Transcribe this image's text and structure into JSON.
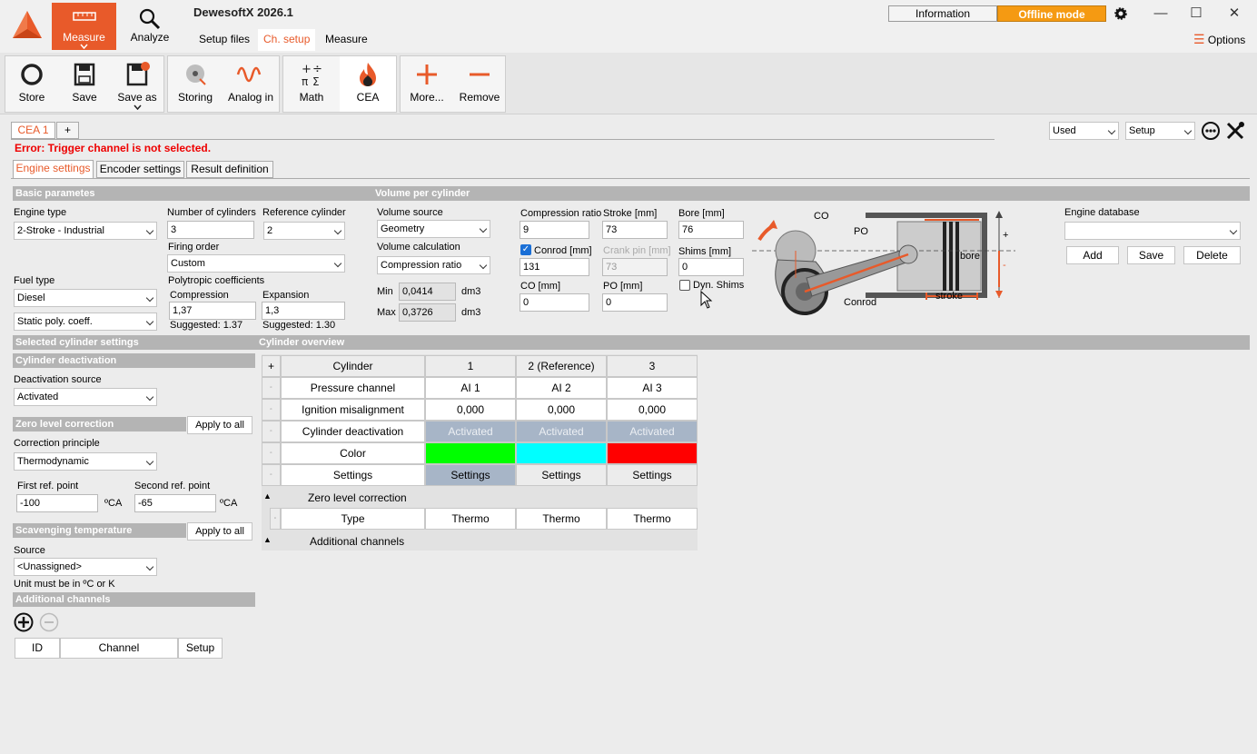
{
  "app": {
    "title": "DewesoftX 2026.1",
    "info_label": "Information",
    "offline_label": "Offline mode",
    "options_label": "Options"
  },
  "main_tabs": {
    "measure": "Measure",
    "analyze": "Analyze"
  },
  "sub_tabs": {
    "setup_files": "Setup files",
    "ch_setup": "Ch. setup",
    "measure": "Measure"
  },
  "toolbar": {
    "store": "Store",
    "save": "Save",
    "save_as": "Save as",
    "storing": "Storing",
    "analog_in": "Analog in",
    "math": "Math",
    "cea": "CEA",
    "more": "More...",
    "remove": "Remove"
  },
  "cea": {
    "tab": "CEA 1",
    "add_tab": "+",
    "filter": "Used",
    "setup": "Setup",
    "error": "Error: Trigger channel is not selected.",
    "inner_tabs": [
      "Engine settings",
      "Encoder settings",
      "Result definition"
    ]
  },
  "basic": {
    "header": "Basic parametes",
    "engine_type_label": "Engine type",
    "engine_type": "2-Stroke - Industrial",
    "cyl_label": "Number of cylinders",
    "cyl": "3",
    "ref_label": "Reference cylinder",
    "ref": "2",
    "firing_label": "Firing order",
    "firing": "Custom",
    "fuel_label": "Fuel type",
    "fuel": "Diesel",
    "poly_mode": "Static poly. coeff.",
    "poly_label": "Polytropic coefficients",
    "comp_label": "Compression",
    "comp": "1,37",
    "exp_label": "Expansion",
    "exp": "1,3",
    "sugg_comp": "Suggested: 1.37",
    "sugg_exp": "Suggested: 1.30"
  },
  "volume": {
    "header": "Volume per cylinder",
    "source_label": "Volume source",
    "source": "Geometry",
    "calc_label": "Volume calculation",
    "calc": "Compression ratio",
    "min_label": "Min",
    "min": "0,0414",
    "max_label": "Max",
    "max": "0,3726",
    "unit": "dm3",
    "cr_label": "Compression ratio",
    "cr": "9",
    "stroke_label": "Stroke [mm]",
    "stroke": "73",
    "bore_label": "Bore [mm]",
    "bore": "76",
    "conrod_label": "Conrod [mm]",
    "conrod": "131",
    "crank_label": "Crank pin [mm]",
    "crank": "73",
    "shims_label": "Shims [mm]",
    "shims": "0",
    "co_label": "CO [mm]",
    "co": "0",
    "po_label": "PO [mm]",
    "po": "0",
    "dyn_shims": "Dyn. Shims",
    "diagram": {
      "co": "CO",
      "po": "PO",
      "bore": "bore",
      "conrod": "Conrod",
      "stroke": "stroke",
      "plus": "+",
      "minus": "-"
    }
  },
  "engine_db": {
    "label": "Engine database",
    "add": "Add",
    "save": "Save",
    "delete": "Delete"
  },
  "selected": {
    "header": "Selected cylinder settings",
    "deact_header": "Cylinder deactivation",
    "deact_src_label": "Deactivation source",
    "deact_src": "Activated",
    "zero_header": "Zero level correction",
    "apply_all": "Apply to all",
    "principle_label": "Correction principle",
    "principle": "Thermodynamic",
    "first_label": "First ref. point",
    "first": "-100",
    "second_label": "Second ref. point",
    "second": "-65",
    "deg": "ºCA",
    "scav_header": "Scavenging temperature",
    "source_label": "Source",
    "source": "<Unassigned>",
    "unit_note": "Unit must be in ºC or K",
    "add_header": "Additional channels",
    "cols": [
      "ID",
      "Channel",
      "Setup"
    ]
  },
  "overview": {
    "header": "Cylinder overview",
    "plus": "+",
    "col_header": "Cylinder",
    "cols": [
      "1",
      "2 (Reference)",
      "3"
    ],
    "rows": [
      {
        "label": "Pressure channel",
        "values": [
          "AI 1",
          "AI 2",
          "AI 3"
        ]
      },
      {
        "label": "Ignition misalignment",
        "values": [
          "0,000",
          "0,000",
          "0,000"
        ]
      },
      {
        "label": "Cylinder deactivation",
        "values": [
          "Activated",
          "Activated",
          "Activated"
        ]
      },
      {
        "label": "Color",
        "values": [
          "",
          "",
          ""
        ]
      },
      {
        "label": "Settings",
        "values": [
          "Settings",
          "Settings",
          "Settings"
        ]
      }
    ],
    "colors": [
      "#00ff00",
      "#00ffff",
      "#ff0000"
    ],
    "zero_group": "Zero level correction",
    "type_row": {
      "label": "Type",
      "values": [
        "Thermo",
        "Thermo",
        "Thermo"
      ]
    },
    "add_group": "Additional channels"
  }
}
